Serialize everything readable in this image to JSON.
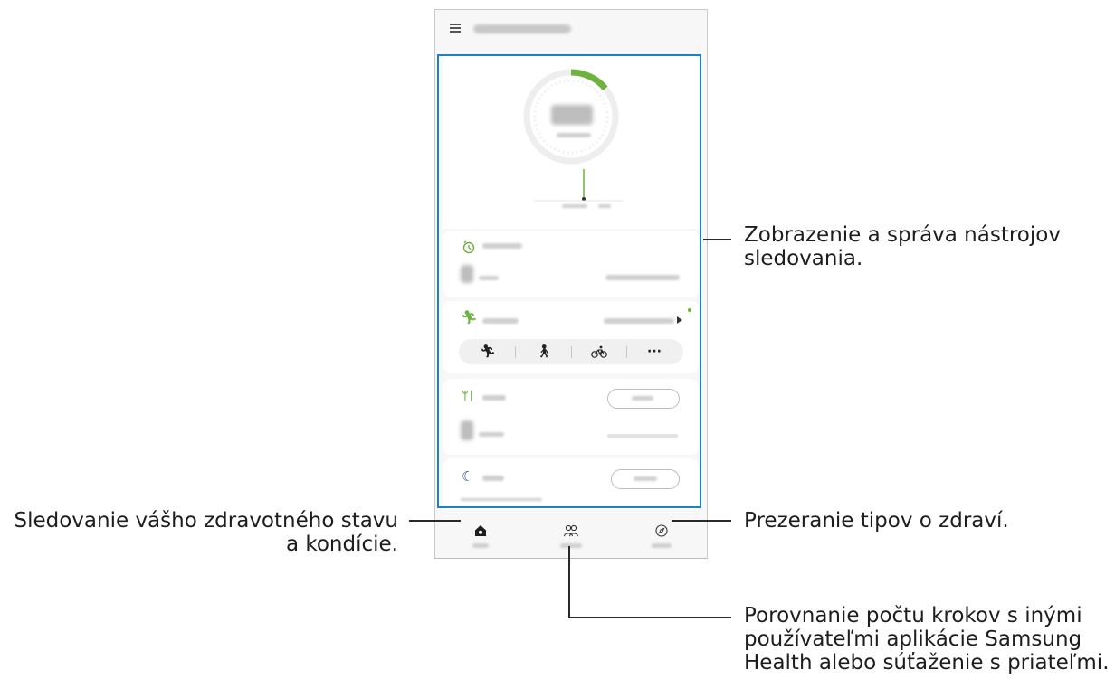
{
  "callouts": {
    "tracking": [
      "Zobrazenie a správa nástrojov",
      "sledovania."
    ],
    "home": [
      "Sledovanie vášho zdravotného stavu",
      "a kondície."
    ],
    "discover": "Prezeranie tipov o zdraví.",
    "together": [
      "Porovnanie počtu krokov s inými",
      "používateľmi aplikácie Samsung",
      "Health alebo súťaženie s priateľmi."
    ]
  },
  "icons": {
    "menu": "hamburger-icon",
    "activity": "timer-icon",
    "exercise": "running-icon",
    "food": "fork-knife-icon",
    "sleep": "crescent-moon-icon",
    "home_tab": "home-icon",
    "together_tab": "people-icon",
    "discover_tab": "compass-icon"
  },
  "exercise_more": "···",
  "colors": {
    "accent_green": "#6cb33f",
    "highlight": "#1f80c4"
  },
  "steps_progress": 0.14
}
